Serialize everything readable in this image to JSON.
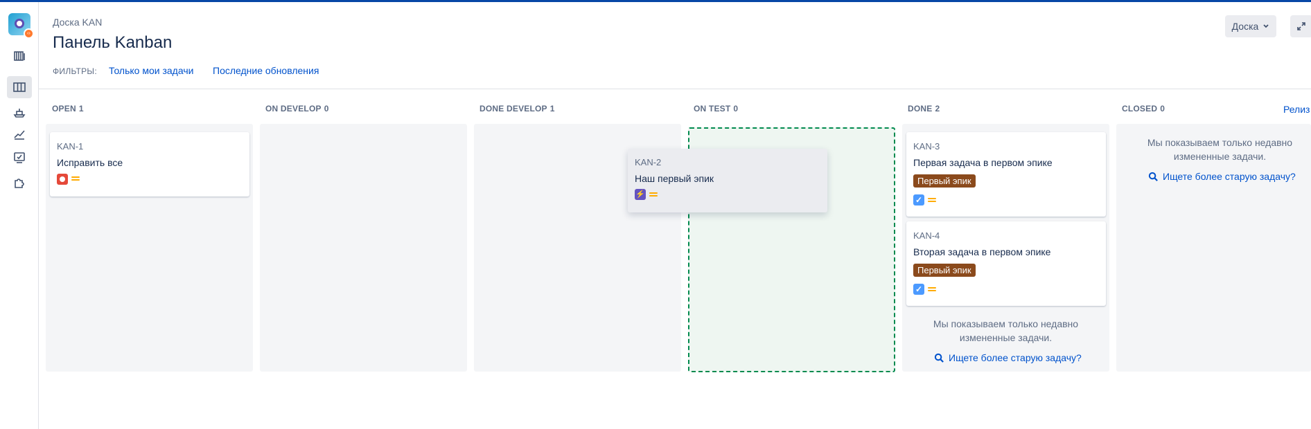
{
  "header": {
    "breadcrumb": "Доска KAN",
    "title": "Панель Kanban",
    "filters_label": "ФИЛЬТРЫ:",
    "filters": [
      "Только мои задачи",
      "Последние обновления"
    ],
    "board_button": "Доска",
    "release_link": "Релиз"
  },
  "nav": {
    "icons": [
      "app-logo-icon",
      "backlog-icon",
      "board-icon",
      "releases-icon",
      "reports-icon",
      "issues-icon",
      "addons-icon"
    ]
  },
  "columns": [
    {
      "name": "OPEN",
      "count": "1"
    },
    {
      "name": "ON DEVELOP",
      "count": "0"
    },
    {
      "name": "DONE DEVELOP",
      "count": "1"
    },
    {
      "name": "ON TEST",
      "count": "0"
    },
    {
      "name": "DONE",
      "count": "2"
    },
    {
      "name": "CLOSED",
      "count": "0"
    }
  ],
  "cards": {
    "kan1": {
      "key": "KAN-1",
      "summary": "Исправить все"
    },
    "kan2": {
      "key": "KAN-2",
      "summary": "Наш первый эпик"
    },
    "kan3": {
      "key": "KAN-3",
      "summary": "Первая задача в первом эпике",
      "epic": "Первый эпик"
    },
    "kan4": {
      "key": "KAN-4",
      "summary": "Вторая задача в первом эпике",
      "epic": "Первый эпик"
    }
  },
  "notes": {
    "recent_line1": "Мы показываем только недавно",
    "recent_line2": "измененные задачи.",
    "older_link": "Ищете более старую задачу?"
  },
  "colors": {
    "accent": "#0052cc",
    "epic_label": "#8b4a1c",
    "drop_target": "#008a4e",
    "bug": "#e5493a",
    "priority": "#ffab00"
  }
}
